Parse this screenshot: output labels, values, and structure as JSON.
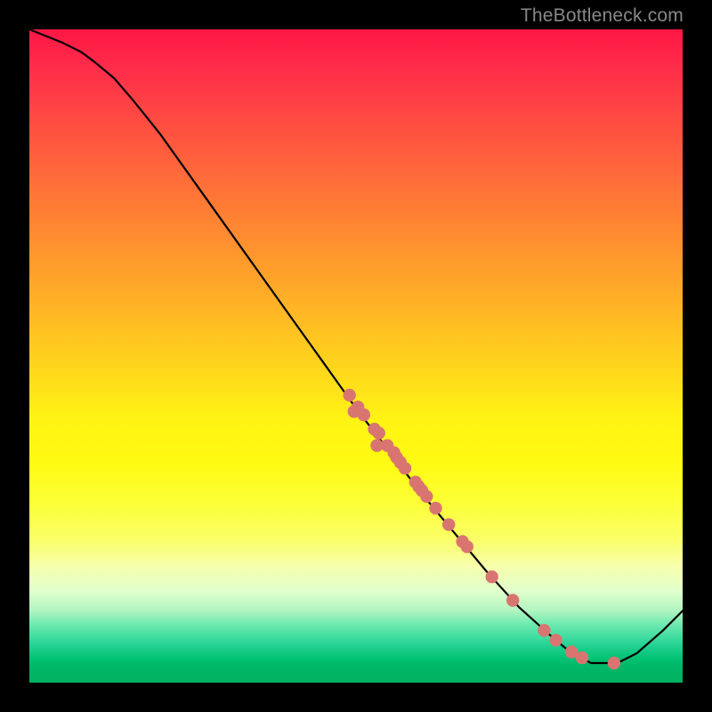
{
  "watermark": "TheBottleneck.com",
  "chart_data": {
    "type": "line",
    "title": "",
    "xlabel": "",
    "ylabel": "",
    "xlim": [
      0,
      100
    ],
    "ylim": [
      0,
      100
    ],
    "grid": false,
    "curve": [
      {
        "x": 0,
        "y": 100
      },
      {
        "x": 5,
        "y": 98
      },
      {
        "x": 8,
        "y": 96.5
      },
      {
        "x": 10,
        "y": 95
      },
      {
        "x": 13,
        "y": 92.5
      },
      {
        "x": 16,
        "y": 89
      },
      {
        "x": 20,
        "y": 84
      },
      {
        "x": 25,
        "y": 77
      },
      {
        "x": 30,
        "y": 70
      },
      {
        "x": 35,
        "y": 63
      },
      {
        "x": 40,
        "y": 56
      },
      {
        "x": 45,
        "y": 49
      },
      {
        "x": 50,
        "y": 42
      },
      {
        "x": 55,
        "y": 35.5
      },
      {
        "x": 60,
        "y": 29
      },
      {
        "x": 65,
        "y": 23
      },
      {
        "x": 70,
        "y": 17
      },
      {
        "x": 75,
        "y": 11.5
      },
      {
        "x": 80,
        "y": 7
      },
      {
        "x": 83,
        "y": 4.5
      },
      {
        "x": 86,
        "y": 3
      },
      {
        "x": 90,
        "y": 3
      },
      {
        "x": 93,
        "y": 4.5
      },
      {
        "x": 97,
        "y": 8
      },
      {
        "x": 100,
        "y": 11
      }
    ],
    "scatter_points": [
      {
        "x": 49,
        "y": 44.0
      },
      {
        "x": 49.7,
        "y": 41.5
      },
      {
        "x": 50.3,
        "y": 42.2
      },
      {
        "x": 51.2,
        "y": 41.0
      },
      {
        "x": 52.8,
        "y": 38.8
      },
      {
        "x": 53.2,
        "y": 36.3
      },
      {
        "x": 53.5,
        "y": 38.2
      },
      {
        "x": 54.8,
        "y": 36.3
      },
      {
        "x": 55.8,
        "y": 35.2
      },
      {
        "x": 56.2,
        "y": 34.5
      },
      {
        "x": 56.8,
        "y": 33.7
      },
      {
        "x": 57.5,
        "y": 32.8
      },
      {
        "x": 59.1,
        "y": 30.7
      },
      {
        "x": 59.6,
        "y": 30.0
      },
      {
        "x": 60.1,
        "y": 29.4
      },
      {
        "x": 60.8,
        "y": 28.5
      },
      {
        "x": 62.2,
        "y": 26.7
      },
      {
        "x": 64.2,
        "y": 24.2
      },
      {
        "x": 66.3,
        "y": 21.6
      },
      {
        "x": 67.0,
        "y": 20.8
      },
      {
        "x": 70.8,
        "y": 16.2
      },
      {
        "x": 74.0,
        "y": 12.6
      },
      {
        "x": 78.8,
        "y": 8.0
      },
      {
        "x": 80.6,
        "y": 6.5
      },
      {
        "x": 83.0,
        "y": 4.7
      },
      {
        "x": 84.6,
        "y": 3.8
      },
      {
        "x": 89.5,
        "y": 3.0
      }
    ],
    "colors": {
      "line": "#000000",
      "points": "#d97570",
      "gradient_top": "#ff1744",
      "gradient_mid": "#ffde1a",
      "gradient_bottom": "#00b060"
    }
  }
}
